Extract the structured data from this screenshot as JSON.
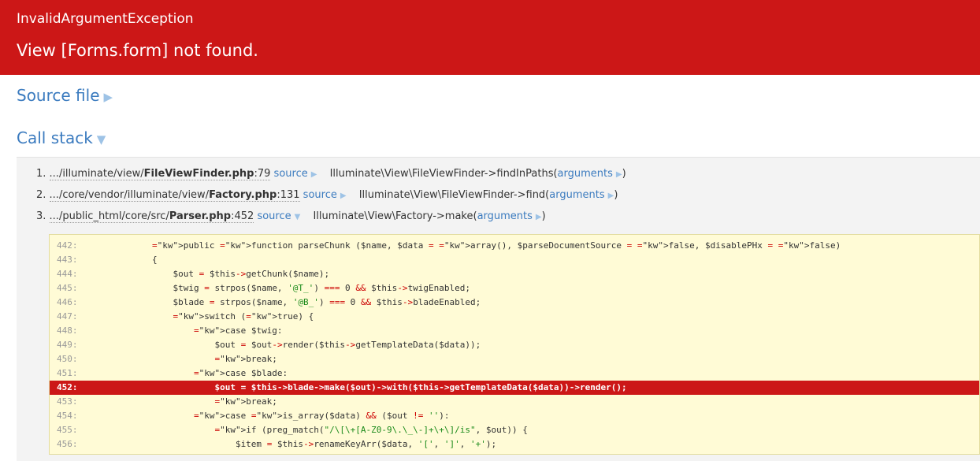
{
  "header": {
    "exception_type": "InvalidArgumentException",
    "message": "View [Forms.form] not found."
  },
  "sections": {
    "source_file": "Source file",
    "call_stack": "Call stack"
  },
  "icons": {
    "collapsed": "triangle-right-icon",
    "expanded": "triangle-down-icon"
  },
  "colors": {
    "header_bg": "#cc1717",
    "link": "#3b7bbf",
    "code_bg": "#fffbd6",
    "highlight": "#cc1717"
  },
  "frames": [
    {
      "num": "1.",
      "path_prefix": ".../illuminate/view/",
      "file": "FileViewFinder.php",
      "line": ":79",
      "source_label": "source",
      "call": "Illuminate\\View\\FileViewFinder->findInPaths(",
      "args_label": "arguments",
      "call_end": ")"
    },
    {
      "num": "2.",
      "path_prefix": ".../core/vendor/illuminate/view/",
      "file": "Factory.php",
      "line": ":131",
      "source_label": "source",
      "call": "Illuminate\\View\\FileViewFinder->find(",
      "args_label": "arguments",
      "call_end": ")"
    },
    {
      "num": "3.",
      "path_prefix": ".../public_html/core/src/",
      "file": "Parser.php",
      "line": ":452",
      "source_label": "source",
      "call": "Illuminate\\View\\Factory->make(",
      "args_label": "arguments",
      "call_end": ")"
    }
  ],
  "code": {
    "highlight_line": "452:",
    "lines": [
      {
        "n": "442:",
        "code": "        public function parseChunk ($name, $data = array(), $parseDocumentSource = false, $disablePHx = false)"
      },
      {
        "n": "443:",
        "code": "        {"
      },
      {
        "n": "444:",
        "code": "            $out = $this->getChunk($name);"
      },
      {
        "n": "445:",
        "code": "            $twig = strpos($name, '@T_') === 0 && $this->twigEnabled;"
      },
      {
        "n": "446:",
        "code": "            $blade = strpos($name, '@B_') === 0 && $this->bladeEnabled;"
      },
      {
        "n": "447:",
        "code": "            switch (true) {"
      },
      {
        "n": "448:",
        "code": "                case $twig:"
      },
      {
        "n": "449:",
        "code": "                    $out = $out->render($this->getTemplateData($data));"
      },
      {
        "n": "450:",
        "code": "                    break;"
      },
      {
        "n": "451:",
        "code": "                case $blade:"
      },
      {
        "n": "452:",
        "code": "                    $out = $this->blade->make($out)->with($this->getTemplateData($data))->render();"
      },
      {
        "n": "453:",
        "code": "                    break;"
      },
      {
        "n": "454:",
        "code": "                case is_array($data) && ($out != ''):"
      },
      {
        "n": "455:",
        "code": "                    if (preg_match(\"/\\[\\+[A-Z0-9\\.\\_\\-]+\\+\\]/is\", $out)) {"
      },
      {
        "n": "456:",
        "code": "                        $item = $this->renameKeyArr($data, '[', ']', '+');"
      }
    ]
  }
}
